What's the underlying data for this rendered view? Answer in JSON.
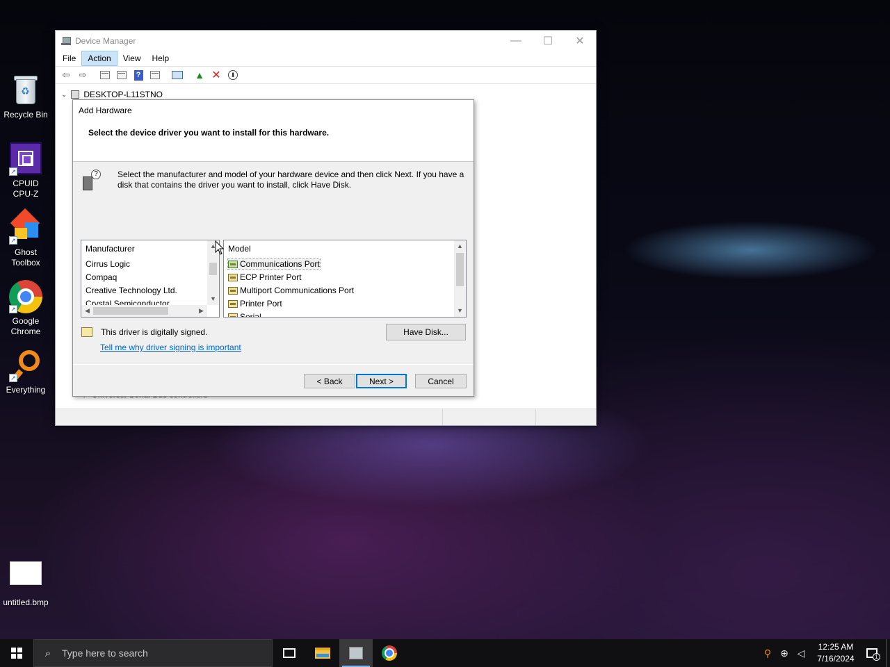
{
  "desktop": {
    "icons": [
      {
        "label": "Recycle Bin",
        "icon": "recycle-bin-icon"
      },
      {
        "label": "CPUID CPU-Z",
        "icon": "cpu-z-icon"
      },
      {
        "label": "Ghost Toolbox",
        "icon": "ghost-toolbox-icon"
      },
      {
        "label": "Google Chrome",
        "icon": "chrome-icon"
      },
      {
        "label": "Everything",
        "icon": "everything-search-icon"
      },
      {
        "label": "untitled.bmp",
        "icon": "bitmap-file-icon"
      }
    ]
  },
  "device_manager": {
    "title": "Device Manager",
    "menu": [
      "File",
      "Action",
      "View",
      "Help"
    ],
    "active_menu": "Action",
    "window_controls": {
      "minimize": "—",
      "maximize": "☐",
      "close": "✕"
    },
    "tree_root": "DESKTOP-L11STNO",
    "tree_partial_item": "Universal Serial Bus controllers"
  },
  "dialog": {
    "title": "Add Hardware",
    "heading": "Select the device driver you want to install for this hardware.",
    "instructions": "Select the manufacturer and model of your hardware device and then click Next. If you have a disk that contains the driver you want to install, click Have Disk.",
    "manufacturer": {
      "header": "Manufacturer",
      "items": [
        "Cirrus Logic",
        "Compaq",
        "Creative Technology Ltd.",
        "Crystal Semiconductor"
      ]
    },
    "model": {
      "header": "Model",
      "items": [
        "Communications Port",
        "ECP Printer Port",
        "Multiport Communications Port",
        "Printer Port",
        "Serial"
      ],
      "selected": "Communications Port"
    },
    "signed_text": "This driver is digitally signed.",
    "signing_link": "Tell me why driver signing is important",
    "buttons": {
      "have_disk": "Have Disk...",
      "back": "< Back",
      "next": "Next >",
      "cancel": "Cancel"
    }
  },
  "taskbar": {
    "search_placeholder": "Type here to search",
    "time": "12:25 AM",
    "date": "7/16/2024",
    "notification_count": "1"
  }
}
